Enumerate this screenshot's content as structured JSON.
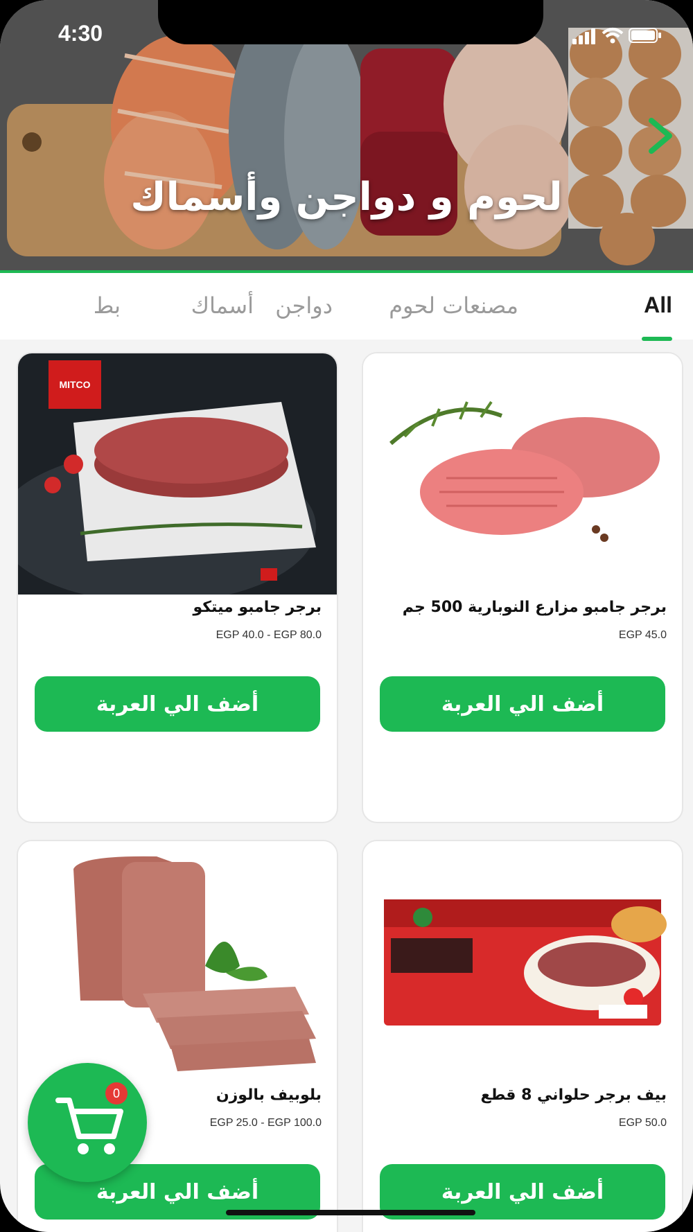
{
  "status_bar": {
    "time": "4:30"
  },
  "hero": {
    "title": "لحوم و دواجن وأسماك"
  },
  "tabs": [
    {
      "label": "All",
      "active": true
    },
    {
      "label": "مصنعات لحوم",
      "active": false
    },
    {
      "label": "دواجن",
      "active": false
    },
    {
      "label": "أسماك",
      "active": false
    },
    {
      "label": "بط",
      "active": false
    }
  ],
  "products": [
    {
      "name": "برجر جامبو مزارع النوبارية 500 جم",
      "price": "EGP 45.0",
      "button": "أضف الي العربة",
      "image": "burger-patties"
    },
    {
      "name": "برجر جامبو ميتكو",
      "price": "EGP 40.0 - EGP 80.0",
      "button": "أضف الي العربة",
      "image": "mitco-burger-box"
    },
    {
      "name": "بيف برجر حلواني 8 قطع",
      "price": "EGP 50.0",
      "button": "أضف الي العربة",
      "image": "beef-burger-pack"
    },
    {
      "name": "بلوبيف بالوزن",
      "price": "EGP 25.0 - EGP 100.0",
      "button": "أضف الي العربة",
      "image": "luncheon-meat"
    }
  ],
  "cart": {
    "count": "0"
  },
  "colors": {
    "accent": "#1db954",
    "badge": "#e53935"
  }
}
